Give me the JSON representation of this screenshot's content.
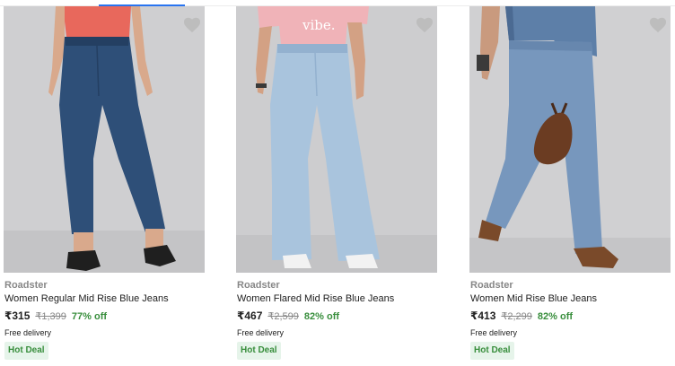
{
  "products": [
    {
      "brand": "Roadster",
      "title": "Women Regular Mid Rise Blue Jeans",
      "price": "₹315",
      "mrp": "₹1,399",
      "discount": "77% off",
      "delivery": "Free delivery",
      "badge": "Hot Deal",
      "image": {
        "shirt_color": "#e8685c",
        "jeans_color": "#2e4f78",
        "shoe_color": "#1f1f1f"
      }
    },
    {
      "brand": "Roadster",
      "title": "Women Flared Mid Rise Blue Jeans",
      "price": "₹467",
      "mrp": "₹2,599",
      "discount": "82% off",
      "delivery": "Free delivery",
      "badge": "Hot Deal",
      "image": {
        "shirt_color": "#f0b3b8",
        "shirt_text": "vibe.",
        "jeans_color": "#a9c4dd",
        "shoe_color": "#f2f2f2"
      }
    },
    {
      "brand": "Roadster",
      "title": "Women Mid Rise Blue Jeans",
      "price": "₹413",
      "mrp": "₹2,299",
      "discount": "82% off",
      "delivery": "Free delivery",
      "badge": "Hot Deal",
      "image": {
        "jacket_color": "#5d7fa8",
        "jeans_color": "#7797bd",
        "bag_color": "#6b3c22",
        "shoe_color": "#7a4a2a"
      }
    }
  ],
  "colors": {
    "image_bg": "#cfcfd1",
    "wishlist_icon": "#bdbdbd",
    "discount_green": "#388e3c",
    "badge_bg": "#e6f4ea"
  }
}
